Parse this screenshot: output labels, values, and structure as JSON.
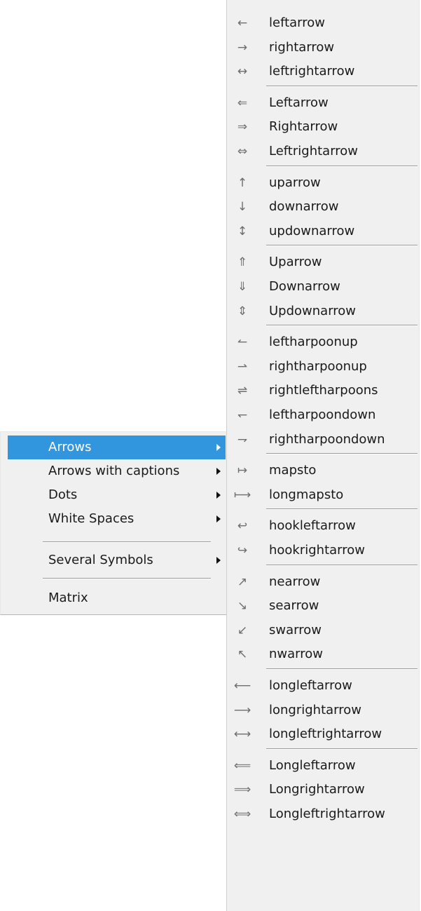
{
  "main_menu": {
    "items": [
      {
        "label": "Arrows",
        "has_submenu": true,
        "selected": true
      },
      {
        "label": "Arrows with captions",
        "has_submenu": true
      },
      {
        "label": "Dots",
        "has_submenu": true
      },
      {
        "label": "White Spaces",
        "has_submenu": true
      },
      {
        "label": "Several Symbols",
        "has_submenu": true
      },
      {
        "label": "Matrix",
        "has_submenu": false
      }
    ]
  },
  "submenu": {
    "groups": [
      [
        {
          "glyph": "←",
          "label": "leftarrow"
        },
        {
          "glyph": "→",
          "label": "rightarrow"
        },
        {
          "glyph": "↔",
          "label": "leftrightarrow"
        }
      ],
      [
        {
          "glyph": "⇐",
          "label": "Leftarrow"
        },
        {
          "glyph": "⇒",
          "label": "Rightarrow"
        },
        {
          "glyph": "⇔",
          "label": "Leftrightarrow"
        }
      ],
      [
        {
          "glyph": "↑",
          "label": "uparrow"
        },
        {
          "glyph": "↓",
          "label": "downarrow"
        },
        {
          "glyph": "↕",
          "label": "updownarrow"
        }
      ],
      [
        {
          "glyph": "⇑",
          "label": "Uparrow"
        },
        {
          "glyph": "⇓",
          "label": "Downarrow"
        },
        {
          "glyph": "⇕",
          "label": "Updownarrow"
        }
      ],
      [
        {
          "glyph": "↼",
          "label": "leftharpoonup"
        },
        {
          "glyph": "⇀",
          "label": "rightharpoonup"
        },
        {
          "glyph": "⇌",
          "label": "rightleftharpoons"
        },
        {
          "glyph": "↽",
          "label": "leftharpoondown"
        },
        {
          "glyph": "⇁",
          "label": "rightharpoondown"
        }
      ],
      [
        {
          "glyph": "↦",
          "label": "mapsto"
        },
        {
          "glyph": "⟼",
          "label": "longmapsto"
        }
      ],
      [
        {
          "glyph": "↩",
          "label": "hookleftarrow"
        },
        {
          "glyph": "↪",
          "label": "hookrightarrow"
        }
      ],
      [
        {
          "glyph": "↗",
          "label": "nearrow"
        },
        {
          "glyph": "↘",
          "label": "searrow"
        },
        {
          "glyph": "↙",
          "label": "swarrow"
        },
        {
          "glyph": "↖",
          "label": "nwarrow"
        }
      ],
      [
        {
          "glyph": "⟵",
          "label": "longleftarrow"
        },
        {
          "glyph": "⟶",
          "label": "longrightarrow"
        },
        {
          "glyph": "⟷",
          "label": "longleftrightarrow"
        }
      ],
      [
        {
          "glyph": "⟸",
          "label": "Longleftarrow"
        },
        {
          "glyph": "⟹",
          "label": "Longrightarrow"
        },
        {
          "glyph": "⟺",
          "label": "Longleftrightarrow"
        }
      ]
    ]
  },
  "colors": {
    "menu_background": "#f0f0f0",
    "selection_highlight": "#3296de",
    "separator": "#9c9c9c"
  }
}
